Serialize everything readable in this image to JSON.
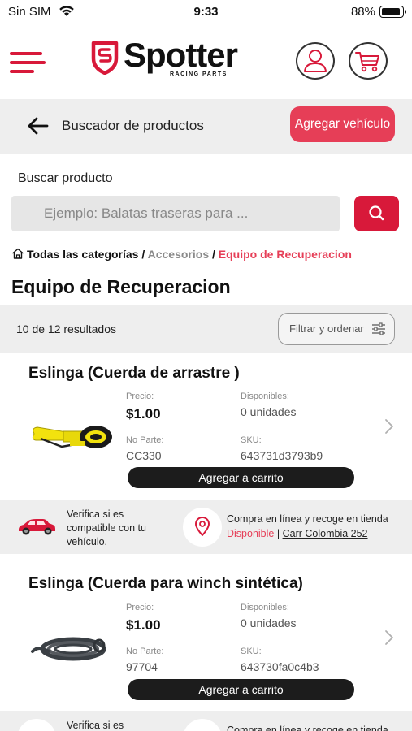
{
  "status_bar": {
    "carrier": "Sin SIM",
    "time": "9:33",
    "battery": "88%"
  },
  "header": {
    "brand": "Spotter",
    "tagline": "RACING PARTS",
    "brand_color": "#d8193a"
  },
  "search_header": {
    "title": "Buscador de productos",
    "add_vehicle_label": "Agregar vehículo"
  },
  "search": {
    "label": "Buscar producto",
    "placeholder": "Ejemplo: Balatas traseras para ..."
  },
  "breadcrumb": {
    "items": [
      "Todas las categorías",
      "Accesorios",
      "Equipo de Recuperacion"
    ],
    "separator": "/"
  },
  "page_title": "Equipo de Recuperacion",
  "results": {
    "count_text": "10 de 12 resultados",
    "filter_label": "Filtrar y ordenar"
  },
  "labels": {
    "price": "Precio:",
    "available": "Disponibles:",
    "part_no": "No Parte:",
    "sku": "SKU:",
    "add_to_cart": "Agregar a carrito"
  },
  "products": [
    {
      "name": "Eslinga (Cuerda de arrastre )",
      "price": "$1.00",
      "available": "0 unidades",
      "part_no": "CC330",
      "sku": "643731d3793b9",
      "image_icon": "yellow-tow-strap"
    },
    {
      "name": "Eslinga (Cuerda para winch sintética)",
      "price": "$1.00",
      "available": "0 unidades",
      "part_no": "97704",
      "sku": "643730fa0c4b3",
      "image_icon": "grey-winch-rope"
    }
  ],
  "info_strip": {
    "compat_text": "Verifica si es compatible con tu vehículo.",
    "pickup_title": "Compra en línea y recoge en tienda",
    "pickup_status": "Disponible",
    "pickup_separator": "|",
    "pickup_store": "Carr Colombia 252",
    "compat_text_partial": "Verifica si es",
    "pickup_title_partial": "Compra en línea y recoge en tienda"
  },
  "colors": {
    "accent": "#e63e57",
    "brand_red": "#d8193a",
    "panel_grey": "#eeeeee",
    "button_dark": "#1c1c1c"
  }
}
